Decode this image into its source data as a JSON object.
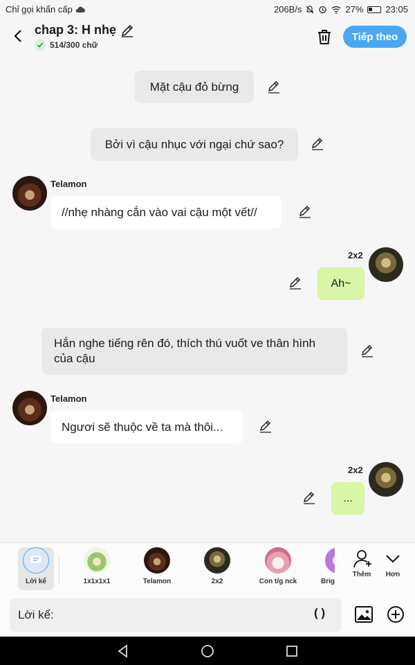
{
  "status": {
    "carrier": "Chỉ gọi khẩn cấp",
    "speed": "206B/s",
    "battery": "27%",
    "time": "23:05"
  },
  "header": {
    "title": "chap 3: H nhẹ",
    "wordcount": "514/300 chữ",
    "next_label": "Tiếp theo"
  },
  "messages": {
    "m1": "Mặt cậu đỏ bừng",
    "m2": "Bởi vì cậu nhục với ngại chứ sao?",
    "m3_name": "Telamon",
    "m3": "//nhẹ nhàng cắn vào vai cậu một vết//",
    "m4_name": "2x2",
    "m4": "Ah~",
    "m5": "Hắn nghe tiếng rên đó, thích thú vuốt ve thân hình của cậu",
    "m6_name": "Telamon",
    "m6": "Ngươi sẽ thuộc về ta mà thôi...",
    "m7_name": "2x2",
    "m7": "..."
  },
  "characters": {
    "c0": "Lời kể",
    "c1": "1x1x1x1",
    "c2": "Telamon",
    "c3": "2x2",
    "c4": "Con t/g nck",
    "c5": "Brigh",
    "more": "Thêm",
    "less": "Hơn"
  },
  "input": {
    "placeholder": "Lời kể:",
    "paren": "( )"
  },
  "colors": {
    "accent": "#4aa8f2",
    "green_bubble": "#d9f5a6",
    "narration_bg": "#e9e9e9"
  }
}
